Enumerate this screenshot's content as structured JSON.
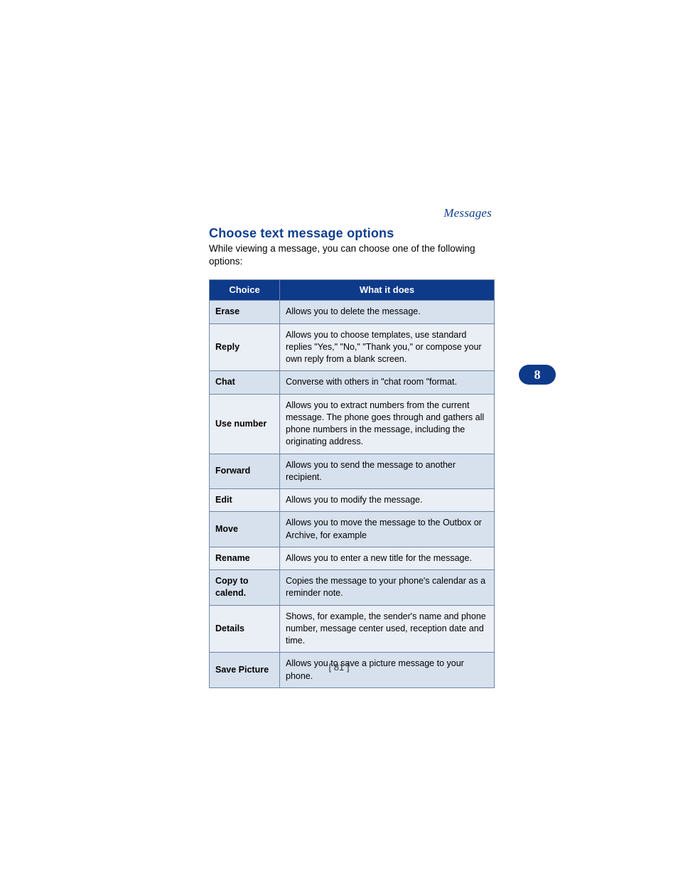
{
  "running_head": "Messages",
  "section_title": "Choose text message options",
  "intro": "While viewing a message, you can choose one of the following options:",
  "thumb_tab": "8",
  "page_number": "[ 81 ]",
  "table": {
    "headers": {
      "choice": "Choice",
      "desc": "What it does"
    },
    "rows": [
      {
        "choice": "Erase",
        "desc": "Allows you to delete the message."
      },
      {
        "choice": "Reply",
        "desc": "Allows you to choose templates, use standard replies \"Yes,\" \"No,\"  \"Thank you,\" or compose your own reply from a blank screen."
      },
      {
        "choice": "Chat",
        "desc": "Converse with others in \"chat room \"format."
      },
      {
        "choice": "Use number",
        "desc": "Allows you to extract numbers from the current message. The phone goes through and gathers all phone numbers in the message, including the originating address."
      },
      {
        "choice": "Forward",
        "desc": "Allows you to send the message to another recipient."
      },
      {
        "choice": "Edit",
        "desc": "Allows you to modify the message."
      },
      {
        "choice": "Move",
        "desc": "Allows you to move the message to the Outbox or Archive, for example"
      },
      {
        "choice": "Rename",
        "desc": "Allows you to enter a new title for the message."
      },
      {
        "choice": "Copy to calend.",
        "desc": "Copies the message to your phone's calendar as a reminder note."
      },
      {
        "choice": "Details",
        "desc": "Shows, for example, the sender's name and phone number, message center used, reception date and time."
      },
      {
        "choice": "Save Picture",
        "desc": "Allows you to save a picture message to your phone."
      }
    ]
  }
}
